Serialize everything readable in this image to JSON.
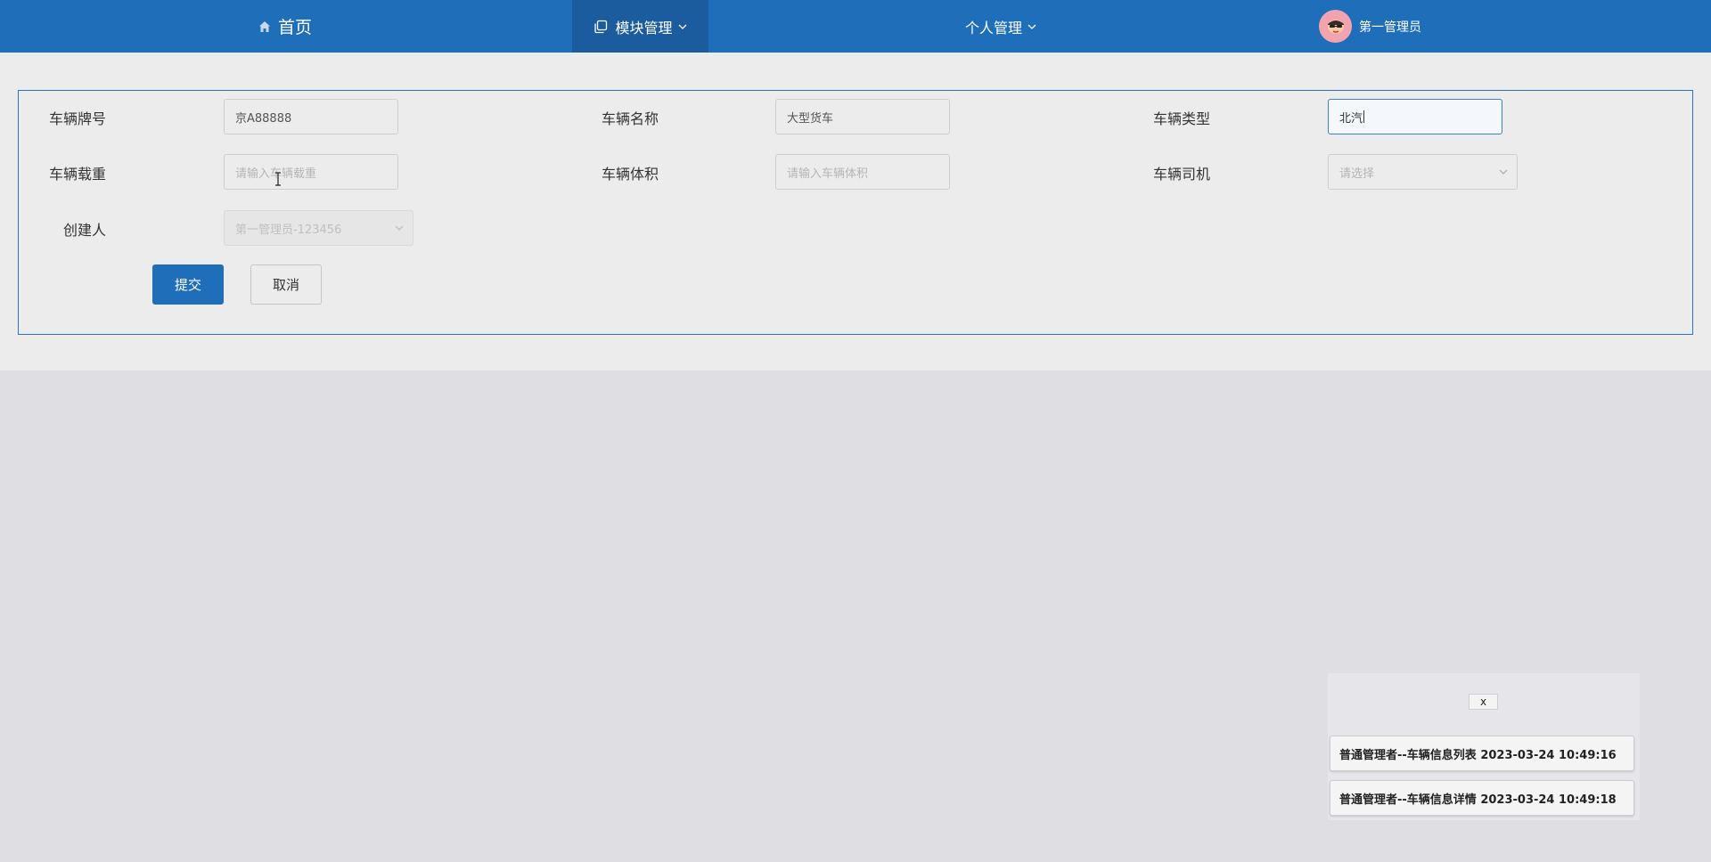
{
  "nav": {
    "home": "首页",
    "module": "模块管理",
    "personal": "个人管理",
    "user": "第一管理员"
  },
  "form": {
    "plate_label": "车辆牌号",
    "plate_value": "京A88888",
    "name_label": "车辆名称",
    "name_value": "大型货车",
    "type_label": "车辆类型",
    "type_value": "北汽",
    "load_label": "车辆载重",
    "load_placeholder": "请输入车辆载重",
    "volume_label": "车辆体积",
    "volume_placeholder": "请输入车辆体积",
    "driver_label": "车辆司机",
    "driver_placeholder": "请选择",
    "creator_label": "创建人",
    "creator_value": "第一管理员-123456",
    "submit": "提交",
    "cancel": "取消"
  },
  "notifications": {
    "close": "x",
    "items": [
      "普通管理者--车辆信息列表 2023-03-24 10:49:16",
      "普通管理者--车辆信息详情 2023-03-24 10:49:18"
    ]
  },
  "colors": {
    "primary": "#1f6eb9",
    "nav_active": "#1a5c9e",
    "panel_border": "#2e73b9"
  }
}
